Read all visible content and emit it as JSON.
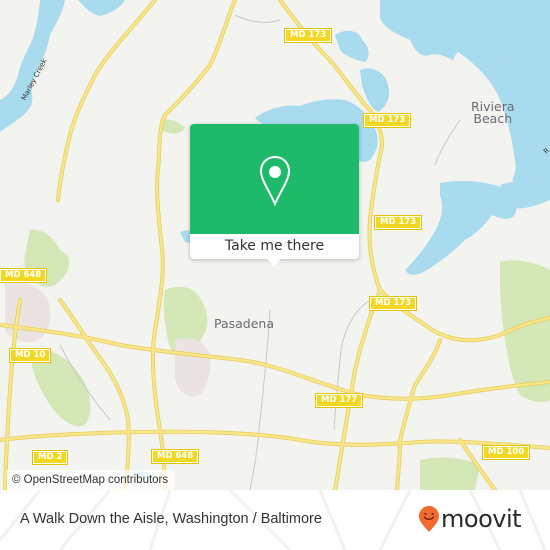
{
  "map": {
    "colors": {
      "land": "#f3f3ef",
      "water": "#a9dbef",
      "park": "#d3e8b6",
      "urban": "#ebe3e1",
      "road": "#f5e37d",
      "road_casing": "#e8cd5a",
      "minor_road": "#c8c8c8"
    },
    "place_labels": {
      "riviera_beach": "Riviera\nBeach",
      "riviera_line1": "Riviera",
      "riviera_line2": "Beach",
      "pasadena": "Pasadena"
    },
    "water_labels": {
      "marley_creek": "Marley Creek",
      "partial_right": "R"
    },
    "route_shields": [
      {
        "id": "md173-a",
        "label": "MD 173"
      },
      {
        "id": "md173-b",
        "label": "MD 173"
      },
      {
        "id": "md173-c",
        "label": "MD 173"
      },
      {
        "id": "md173-d",
        "label": "MD 173"
      },
      {
        "id": "md648-a",
        "label": "MD 648"
      },
      {
        "id": "md10",
        "label": "MD 10"
      },
      {
        "id": "md177",
        "label": "MD 177"
      },
      {
        "id": "md2",
        "label": "MD 2"
      },
      {
        "id": "md648-b",
        "label": "MD 648"
      },
      {
        "id": "md100",
        "label": "MD 100"
      }
    ],
    "attribution": "© OpenStreetMap contributors"
  },
  "popup": {
    "icon": "map-pin-icon",
    "button_label": "Take me there",
    "accent": "#1fb96a"
  },
  "footer": {
    "title": "A Walk Down the Aisle, Washington / Baltimore",
    "logo_text": "moovit",
    "logo_icon": "moovit-pin-smiley-icon",
    "logo_color": "#f26a2e"
  }
}
